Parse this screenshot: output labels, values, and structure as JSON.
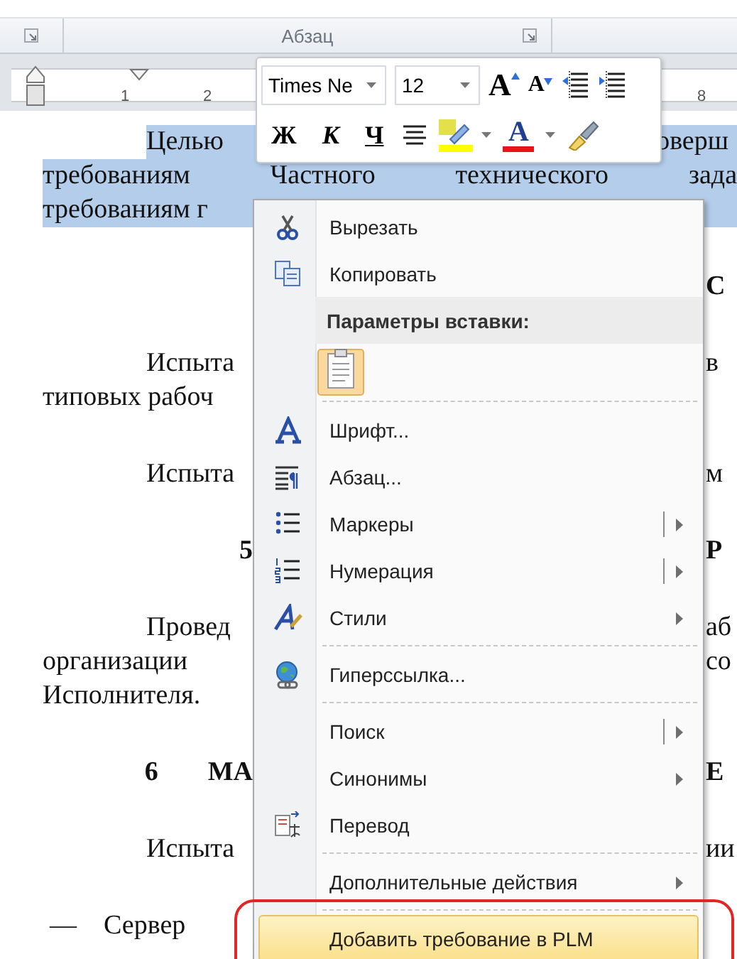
{
  "ribbon": {
    "group_label": "Абзац"
  },
  "ruler": {
    "labels": [
      "1",
      "2",
      "8"
    ]
  },
  "mini_toolbar": {
    "font": "Times Ne",
    "size": "12",
    "row_1": [
      {
        "kind": "grow",
        "text": "A"
      },
      {
        "kind": "shrink",
        "text": "A"
      },
      {
        "kind": "outdent"
      },
      {
        "kind": "indent"
      }
    ],
    "row_2": [
      {
        "kind": "bold",
        "text": "Ж"
      },
      {
        "kind": "italic",
        "text": "К"
      },
      {
        "kind": "underline",
        "text": "Ч"
      },
      {
        "kind": "center"
      },
      {
        "kind": "highlight"
      },
      {
        "kind": "font-color",
        "text": "A"
      },
      {
        "kind": "painter"
      }
    ]
  },
  "document": {
    "paragraphs": [
      {
        "kind": "body",
        "lines": [
          {
            "left": "Целью",
            "right": "оверш",
            "highlighted": true
          },
          {
            "left": "требованиям  Частного  технического  зада",
            "full": true,
            "highlighted": true
          },
          {
            "left": "требованиям г",
            "highlighted": true
          }
        ]
      },
      {
        "kind": "heading",
        "lines": [
          {
            "right": "С",
            "highlighted": false
          }
        ]
      },
      {
        "kind": "body",
        "lines": [
          {
            "left": "Испыта",
            "right": "в",
            "highlighted": false
          },
          {
            "left": "типовых рабоч",
            "highlighted": false
          }
        ]
      },
      {
        "kind": "body",
        "lines": [
          {
            "left": "Испыта",
            "right": "м",
            "highlighted": false
          }
        ]
      },
      {
        "kind": "heading",
        "lines": [
          {
            "number": "5",
            "right": "Р",
            "highlighted": false
          }
        ]
      },
      {
        "kind": "body",
        "lines": [
          {
            "left": "Провед",
            "right": "аб",
            "highlighted": false
          },
          {
            "left": "организации",
            "right": "со",
            "highlighted": false
          },
          {
            "left": "Исполнителя.",
            "highlighted": false
          }
        ]
      },
      {
        "kind": "heading",
        "lines": [
          {
            "number": "6",
            "left": "МА",
            "right": "Е",
            "highlighted": false
          }
        ]
      },
      {
        "kind": "body",
        "lines": [
          {
            "left": "Испыта",
            "right": "ии",
            "highlighted": false
          }
        ]
      },
      {
        "kind": "dash",
        "lines": [
          {
            "marker": "—",
            "left": "Сервер",
            "highlighted": false
          }
        ]
      }
    ]
  },
  "context_menu": {
    "items": [
      {
        "kind": "command",
        "label": "Вырезать",
        "submenu_arrow": false,
        "split": false,
        "highlighted": false,
        "outlined": false
      },
      {
        "kind": "command",
        "label": "Копировать",
        "submenu_arrow": false,
        "split": false,
        "highlighted": false,
        "outlined": false
      },
      {
        "kind": "header",
        "label": "Параметры вставки:"
      },
      {
        "kind": "paste"
      },
      {
        "kind": "separator"
      },
      {
        "kind": "command",
        "label": "Шрифт...",
        "submenu_arrow": false,
        "split": false,
        "highlighted": false,
        "outlined": false
      },
      {
        "kind": "command",
        "label": "Абзац...",
        "submenu_arrow": false,
        "split": false,
        "highlighted": false,
        "outlined": false
      },
      {
        "kind": "command",
        "label": "Маркеры",
        "submenu_arrow": true,
        "split": true,
        "highlighted": false,
        "outlined": false
      },
      {
        "kind": "command",
        "label": "Нумерация",
        "submenu_arrow": true,
        "split": true,
        "highlighted": false,
        "outlined": false
      },
      {
        "kind": "command",
        "label": "Стили",
        "submenu_arrow": true,
        "split": false,
        "highlighted": false,
        "outlined": false
      },
      {
        "kind": "separator"
      },
      {
        "kind": "command",
        "label": "Гиперссылка...",
        "submenu_arrow": false,
        "split": false,
        "highlighted": false,
        "outlined": false
      },
      {
        "kind": "separator"
      },
      {
        "kind": "command",
        "label": "Поиск",
        "submenu_arrow": true,
        "split": true,
        "highlighted": false,
        "outlined": false
      },
      {
        "kind": "command",
        "label": "Синонимы",
        "submenu_arrow": true,
        "split": false,
        "highlighted": false,
        "outlined": false
      },
      {
        "kind": "command",
        "label": "Перевод",
        "submenu_arrow": false,
        "split": false,
        "highlighted": false,
        "outlined": false
      },
      {
        "kind": "separator"
      },
      {
        "kind": "command",
        "label": "Дополнительные действия",
        "submenu_arrow": true,
        "split": false,
        "highlighted": false,
        "outlined": false
      },
      {
        "kind": "separator"
      },
      {
        "kind": "command",
        "label": "Добавить требование в PLM",
        "submenu_arrow": false,
        "split": false,
        "highlighted": true,
        "outlined": true
      }
    ]
  }
}
